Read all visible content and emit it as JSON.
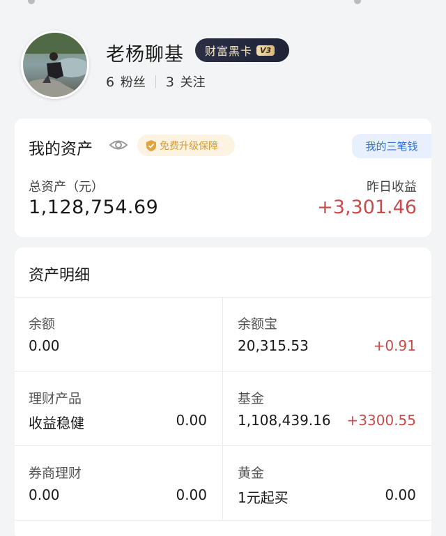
{
  "profile": {
    "name": "老杨聊基",
    "badge_text": "财富黑卡",
    "badge_level": "V3",
    "fans_count": "6",
    "fans_label": "粉丝",
    "follow_count": "3",
    "follow_label": "关注"
  },
  "assets": {
    "title": "我的资产",
    "protect_label": "免费升级保障",
    "three_money_label": "我的三笔钱",
    "total_label": "总资产（元）",
    "total_value": "1,128,754.69",
    "yesterday_label": "昨日收益",
    "yesterday_value": "+3,301.46"
  },
  "detail": {
    "title": "资产明细",
    "items": [
      {
        "name": "余额",
        "value": "0.00",
        "extra": ""
      },
      {
        "name": "余额宝",
        "value": "20,315.53",
        "extra": "+0.91"
      },
      {
        "name": "理财产品",
        "value": "收益稳健",
        "extra": "0.00"
      },
      {
        "name": "基金",
        "value": "1,108,439.16",
        "extra": "+3300.55"
      },
      {
        "name": "券商理财",
        "value": "0.00",
        "extra": "0.00"
      },
      {
        "name": "黄金",
        "value": "1元起买",
        "extra": "0.00"
      }
    ]
  },
  "colors": {
    "accent_red": "#c84b4b",
    "link_blue": "#2f6fd6",
    "badge_gold": "#d99a33"
  }
}
